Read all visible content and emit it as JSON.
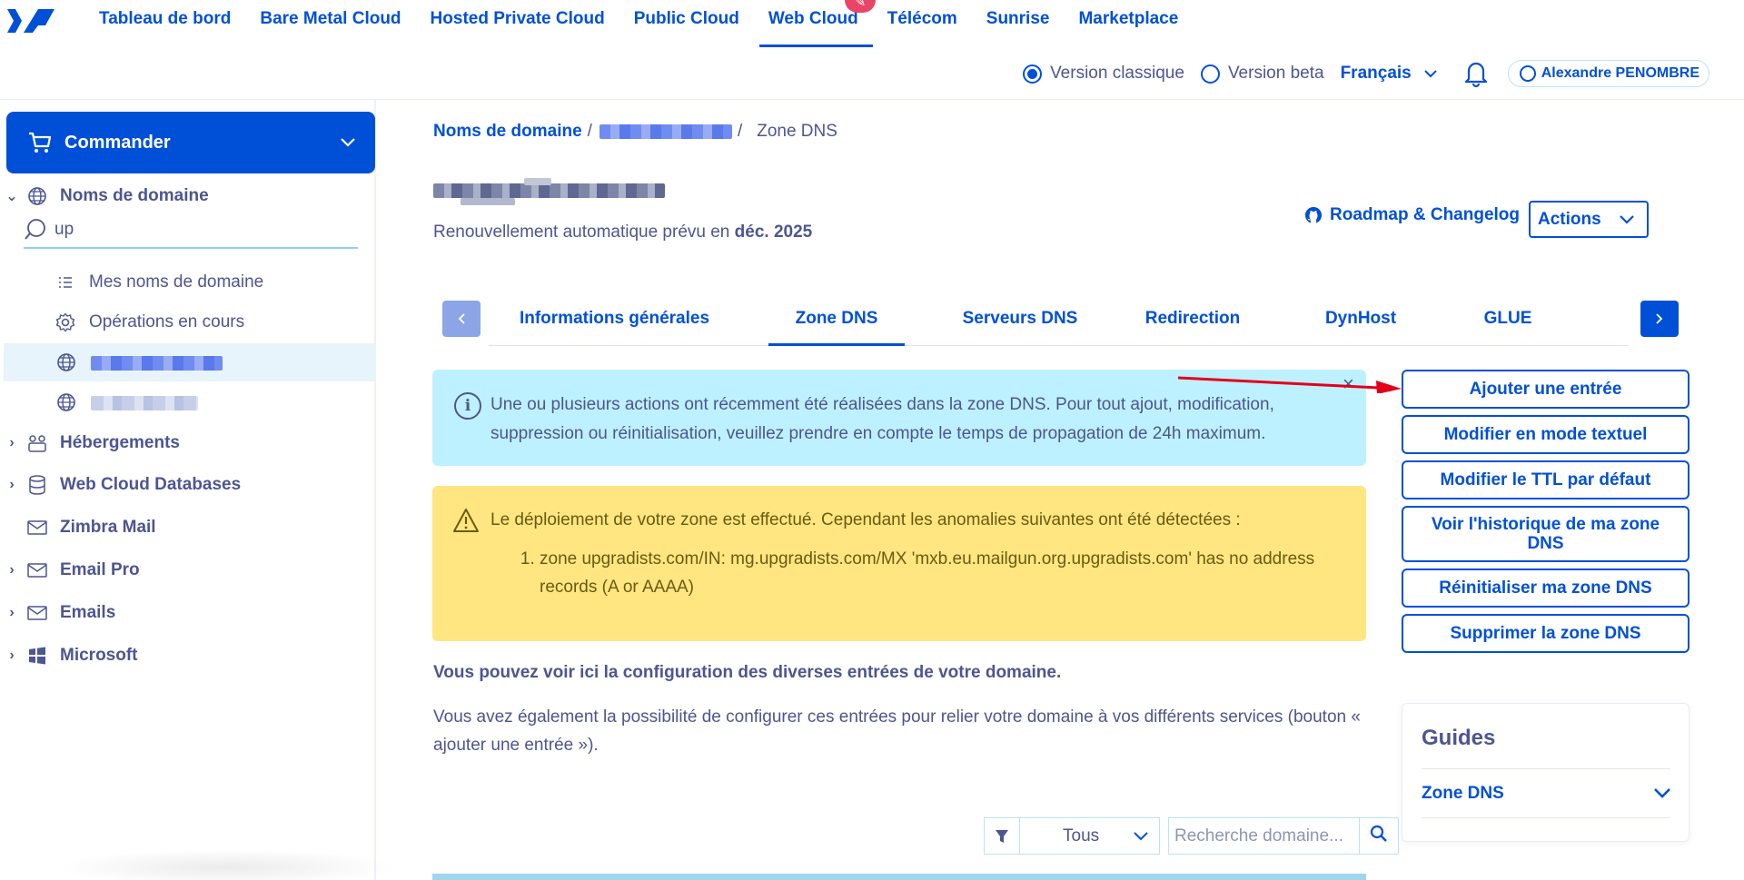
{
  "topnav": {
    "universes": [
      "Tableau de bord",
      "Bare Metal Cloud",
      "Hosted Private Cloud",
      "Public Cloud",
      "Web Cloud",
      "Télécom",
      "Sunrise",
      "Marketplace"
    ],
    "active_universe": "Web Cloud",
    "version_classic": "Version classique",
    "version_beta": "Version beta",
    "language": "Français",
    "user_name": "Alexandre PENOMBRE"
  },
  "sidebar": {
    "order_label": "Commander",
    "domains_label": "Noms de domaine",
    "search_value": "up",
    "my_domains": "Mes noms de domaine",
    "operations": "Opérations en cours",
    "hosting": "Hébergements",
    "databases": "Web Cloud Databases",
    "zimbra": "Zimbra Mail",
    "email_pro": "Email Pro",
    "emails": "Emails",
    "microsoft": "Microsoft"
  },
  "main": {
    "breadcrumb_root": "Noms de domaine",
    "breadcrumb_sep1": "/",
    "breadcrumb_sep2": "/",
    "breadcrumb_current": "Zone DNS",
    "renewal_prefix": "Renouvellement automatique prévu en",
    "renewal_date": "déc. 2025",
    "roadmap": "Roadmap & Changelog",
    "actions": "Actions",
    "tabs": [
      "Informations générales",
      "Zone DNS",
      "Serveurs DNS",
      "Redirection",
      "DynHost",
      "GLUE"
    ],
    "active_tab": "Zone DNS",
    "info_message": "Une ou plusieurs actions ont récemment été réalisées dans la zone DNS. Pour tout ajout, modification, suppression ou réinitialisation, veuillez prendre en compte le temps de propagation de 24h maximum.",
    "warning_title": "Le déploiement de votre zone est effectué. Cependant les anomalies suivantes ont été détectées :",
    "warning_item": "zone upgradists.com/IN: mg.upgradists.com/MX 'mxb.eu.mailgun.org.upgradists.com' has no address records (A or AAAA)",
    "intro_strong": "Vous pouvez voir ici la configuration des diverses entrées de votre domaine.",
    "intro_text": "Vous avez également la possibilité de configurer ces entrées pour relier votre domaine à vos différents services (bouton « ajouter une entrée »).",
    "filter_value": "Tous",
    "search_placeholder": "Recherche domaine..."
  },
  "actions_panel": {
    "add_entry": "Ajouter une entrée",
    "edit_text": "Modifier en mode textuel",
    "edit_ttl": "Modifier le TTL par défaut",
    "history": "Voir l'historique de ma zone DNS",
    "reset": "Réinitialiser ma zone DNS",
    "delete": "Supprimer la zone DNS"
  },
  "guides": {
    "title": "Guides",
    "item": "Zone DNS"
  },
  "colors": {
    "primary": "#0050d7",
    "text": "#4d5592",
    "info_bg": "#bef1ff",
    "warning_bg": "#ffe680",
    "annotation_arrow": "#e3001b"
  }
}
